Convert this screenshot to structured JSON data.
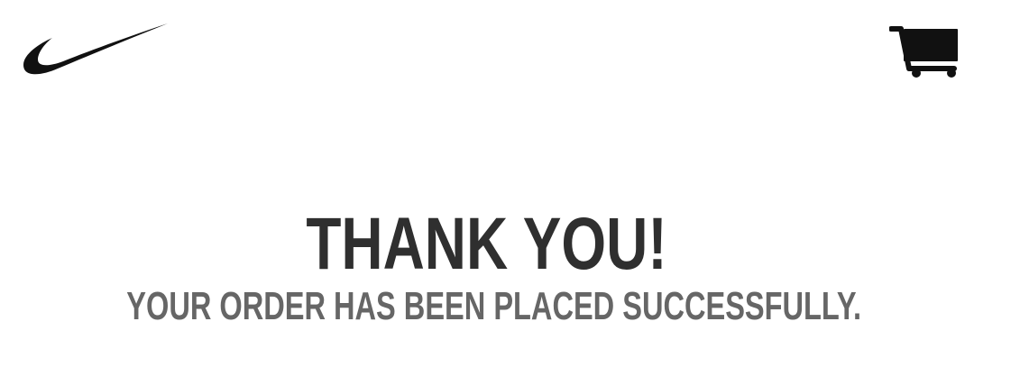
{
  "header": {
    "logo_icon": "swoosh-logo-icon",
    "cart_icon": "shopping-cart-icon"
  },
  "confirmation": {
    "title": "THANK YOU!",
    "message": "YOUR ORDER HAS BEEN PLACED SUCCESSFULLY."
  },
  "colors": {
    "background": "#ffffff",
    "logo": "#111111",
    "title": "#2f2f2f",
    "message": "#666666"
  }
}
